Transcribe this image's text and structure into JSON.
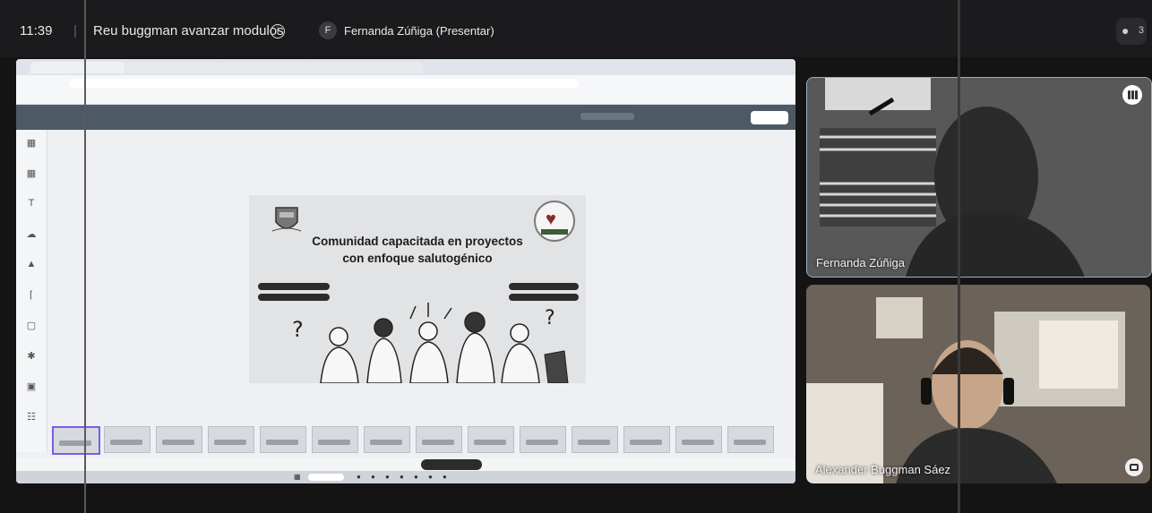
{
  "meeting": {
    "time": "11:39",
    "title": "Reu buggman avanzar modulos",
    "presenter_initial": "F",
    "presenter_label": "Fernanda Zúñiga (Presentar)",
    "participant_count": "3"
  },
  "slide": {
    "title_line1": "Comunidad capacitada en proyectos",
    "title_line2": "con enfoque salutogénico"
  },
  "participants": [
    {
      "name": "Fernanda Zúñiga"
    },
    {
      "name": "Alexander Buggman Sáez"
    }
  ],
  "colors": {
    "meet_bg": "#141414",
    "canva_toolbar": "#4d5a66",
    "tile_border": "#8fb2d9"
  }
}
